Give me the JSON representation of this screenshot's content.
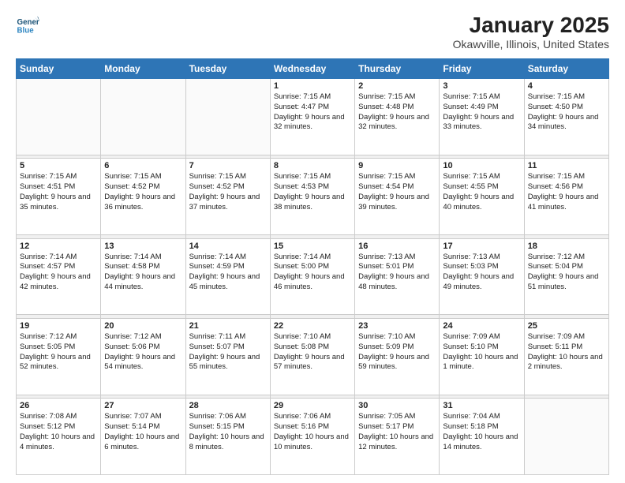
{
  "header": {
    "logo_line1": "General",
    "logo_line2": "Blue",
    "month": "January 2025",
    "location": "Okawville, Illinois, United States"
  },
  "weekdays": [
    "Sunday",
    "Monday",
    "Tuesday",
    "Wednesday",
    "Thursday",
    "Friday",
    "Saturday"
  ],
  "weeks": [
    [
      {
        "day": "",
        "sunrise": "",
        "sunset": "",
        "daylight": ""
      },
      {
        "day": "",
        "sunrise": "",
        "sunset": "",
        "daylight": ""
      },
      {
        "day": "",
        "sunrise": "",
        "sunset": "",
        "daylight": ""
      },
      {
        "day": "1",
        "sunrise": "Sunrise: 7:15 AM",
        "sunset": "Sunset: 4:47 PM",
        "daylight": "Daylight: 9 hours and 32 minutes."
      },
      {
        "day": "2",
        "sunrise": "Sunrise: 7:15 AM",
        "sunset": "Sunset: 4:48 PM",
        "daylight": "Daylight: 9 hours and 32 minutes."
      },
      {
        "day": "3",
        "sunrise": "Sunrise: 7:15 AM",
        "sunset": "Sunset: 4:49 PM",
        "daylight": "Daylight: 9 hours and 33 minutes."
      },
      {
        "day": "4",
        "sunrise": "Sunrise: 7:15 AM",
        "sunset": "Sunset: 4:50 PM",
        "daylight": "Daylight: 9 hours and 34 minutes."
      }
    ],
    [
      {
        "day": "5",
        "sunrise": "Sunrise: 7:15 AM",
        "sunset": "Sunset: 4:51 PM",
        "daylight": "Daylight: 9 hours and 35 minutes."
      },
      {
        "day": "6",
        "sunrise": "Sunrise: 7:15 AM",
        "sunset": "Sunset: 4:52 PM",
        "daylight": "Daylight: 9 hours and 36 minutes."
      },
      {
        "day": "7",
        "sunrise": "Sunrise: 7:15 AM",
        "sunset": "Sunset: 4:52 PM",
        "daylight": "Daylight: 9 hours and 37 minutes."
      },
      {
        "day": "8",
        "sunrise": "Sunrise: 7:15 AM",
        "sunset": "Sunset: 4:53 PM",
        "daylight": "Daylight: 9 hours and 38 minutes."
      },
      {
        "day": "9",
        "sunrise": "Sunrise: 7:15 AM",
        "sunset": "Sunset: 4:54 PM",
        "daylight": "Daylight: 9 hours and 39 minutes."
      },
      {
        "day": "10",
        "sunrise": "Sunrise: 7:15 AM",
        "sunset": "Sunset: 4:55 PM",
        "daylight": "Daylight: 9 hours and 40 minutes."
      },
      {
        "day": "11",
        "sunrise": "Sunrise: 7:15 AM",
        "sunset": "Sunset: 4:56 PM",
        "daylight": "Daylight: 9 hours and 41 minutes."
      }
    ],
    [
      {
        "day": "12",
        "sunrise": "Sunrise: 7:14 AM",
        "sunset": "Sunset: 4:57 PM",
        "daylight": "Daylight: 9 hours and 42 minutes."
      },
      {
        "day": "13",
        "sunrise": "Sunrise: 7:14 AM",
        "sunset": "Sunset: 4:58 PM",
        "daylight": "Daylight: 9 hours and 44 minutes."
      },
      {
        "day": "14",
        "sunrise": "Sunrise: 7:14 AM",
        "sunset": "Sunset: 4:59 PM",
        "daylight": "Daylight: 9 hours and 45 minutes."
      },
      {
        "day": "15",
        "sunrise": "Sunrise: 7:14 AM",
        "sunset": "Sunset: 5:00 PM",
        "daylight": "Daylight: 9 hours and 46 minutes."
      },
      {
        "day": "16",
        "sunrise": "Sunrise: 7:13 AM",
        "sunset": "Sunset: 5:01 PM",
        "daylight": "Daylight: 9 hours and 48 minutes."
      },
      {
        "day": "17",
        "sunrise": "Sunrise: 7:13 AM",
        "sunset": "Sunset: 5:03 PM",
        "daylight": "Daylight: 9 hours and 49 minutes."
      },
      {
        "day": "18",
        "sunrise": "Sunrise: 7:12 AM",
        "sunset": "Sunset: 5:04 PM",
        "daylight": "Daylight: 9 hours and 51 minutes."
      }
    ],
    [
      {
        "day": "19",
        "sunrise": "Sunrise: 7:12 AM",
        "sunset": "Sunset: 5:05 PM",
        "daylight": "Daylight: 9 hours and 52 minutes."
      },
      {
        "day": "20",
        "sunrise": "Sunrise: 7:12 AM",
        "sunset": "Sunset: 5:06 PM",
        "daylight": "Daylight: 9 hours and 54 minutes."
      },
      {
        "day": "21",
        "sunrise": "Sunrise: 7:11 AM",
        "sunset": "Sunset: 5:07 PM",
        "daylight": "Daylight: 9 hours and 55 minutes."
      },
      {
        "day": "22",
        "sunrise": "Sunrise: 7:10 AM",
        "sunset": "Sunset: 5:08 PM",
        "daylight": "Daylight: 9 hours and 57 minutes."
      },
      {
        "day": "23",
        "sunrise": "Sunrise: 7:10 AM",
        "sunset": "Sunset: 5:09 PM",
        "daylight": "Daylight: 9 hours and 59 minutes."
      },
      {
        "day": "24",
        "sunrise": "Sunrise: 7:09 AM",
        "sunset": "Sunset: 5:10 PM",
        "daylight": "Daylight: 10 hours and 1 minute."
      },
      {
        "day": "25",
        "sunrise": "Sunrise: 7:09 AM",
        "sunset": "Sunset: 5:11 PM",
        "daylight": "Daylight: 10 hours and 2 minutes."
      }
    ],
    [
      {
        "day": "26",
        "sunrise": "Sunrise: 7:08 AM",
        "sunset": "Sunset: 5:12 PM",
        "daylight": "Daylight: 10 hours and 4 minutes."
      },
      {
        "day": "27",
        "sunrise": "Sunrise: 7:07 AM",
        "sunset": "Sunset: 5:14 PM",
        "daylight": "Daylight: 10 hours and 6 minutes."
      },
      {
        "day": "28",
        "sunrise": "Sunrise: 7:06 AM",
        "sunset": "Sunset: 5:15 PM",
        "daylight": "Daylight: 10 hours and 8 minutes."
      },
      {
        "day": "29",
        "sunrise": "Sunrise: 7:06 AM",
        "sunset": "Sunset: 5:16 PM",
        "daylight": "Daylight: 10 hours and 10 minutes."
      },
      {
        "day": "30",
        "sunrise": "Sunrise: 7:05 AM",
        "sunset": "Sunset: 5:17 PM",
        "daylight": "Daylight: 10 hours and 12 minutes."
      },
      {
        "day": "31",
        "sunrise": "Sunrise: 7:04 AM",
        "sunset": "Sunset: 5:18 PM",
        "daylight": "Daylight: 10 hours and 14 minutes."
      },
      {
        "day": "",
        "sunrise": "",
        "sunset": "",
        "daylight": ""
      }
    ]
  ]
}
